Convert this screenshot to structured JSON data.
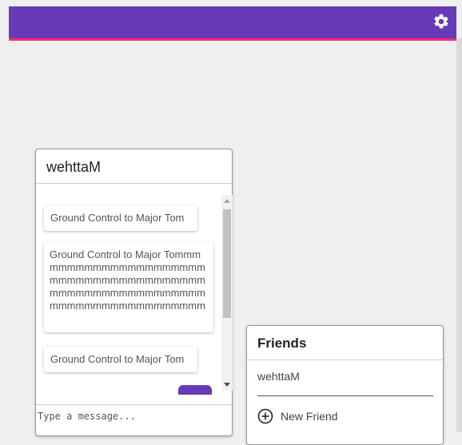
{
  "header": {
    "settings_icon": "gear-icon",
    "bar_color": "#673ab7",
    "accent_color": "#ff2e6e"
  },
  "chat": {
    "title": "wehttaM",
    "messages": [
      {
        "text": "Ground Control to Major Tom"
      },
      {
        "text": "Ground Control to Major Tommmmmmmmmmmmmmmmmmmmmmmmmmmmmmmmmmmmmmmmmmmmmmmmmmmmmmmmmmmmmmmmmmmmmmmmmmm"
      },
      {
        "text": "Ground Control to Major Tom"
      }
    ],
    "input_placeholder": "Type a message..."
  },
  "friends": {
    "title": "Friends",
    "items": [
      {
        "name": "wehttaM"
      }
    ],
    "new_friend_label": "New Friend",
    "new_friend_icon": "plus-circle-icon"
  }
}
